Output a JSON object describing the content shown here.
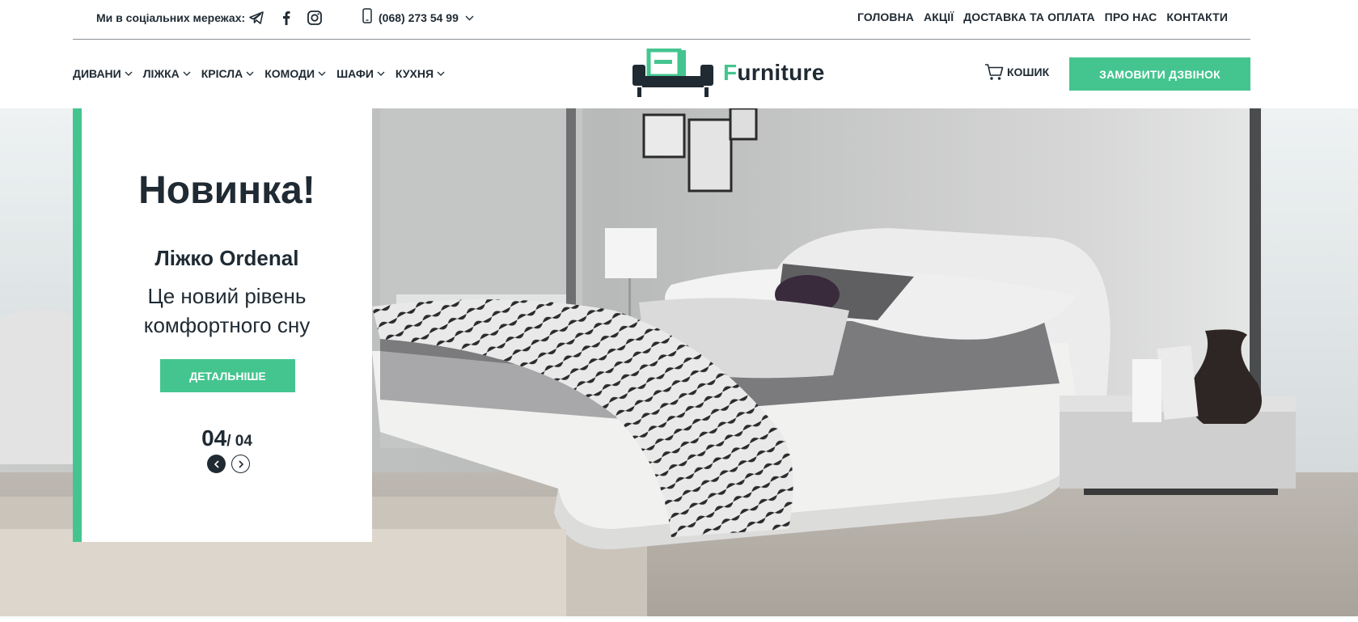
{
  "topbar": {
    "social_label": "Ми в соціальних мережах:",
    "social_icons": [
      "telegram-icon",
      "facebook-icon",
      "instagram-icon"
    ],
    "phone": "(068) 273 54 99",
    "nav": [
      "ГОЛОВНА",
      "АКЦІЇ",
      "ДОСТАВКА ТА ОПЛАТА",
      "ПРО НАС",
      "КОНТАКТИ"
    ]
  },
  "header": {
    "categories": [
      "ДИВАНИ",
      "ЛІЖКА",
      "КРІСЛА",
      "КОМОДИ",
      "ШАФИ",
      "КУХНЯ"
    ],
    "logo_text_first": "F",
    "logo_text_rest": "urniture",
    "cart_label": "КОШИК",
    "callback_label": "ЗАМОВИТИ ДЗВІНОК"
  },
  "hero": {
    "title": "Новинка!",
    "product": "Ліжко Ordenal",
    "description": "Це новий рівень комфортного сну",
    "button_label": "ДЕТАЛЬНІШЕ",
    "slide_current": "04",
    "slide_total": "/ 04"
  },
  "colors": {
    "accent": "#44c58f",
    "dark": "#1f2a33"
  }
}
